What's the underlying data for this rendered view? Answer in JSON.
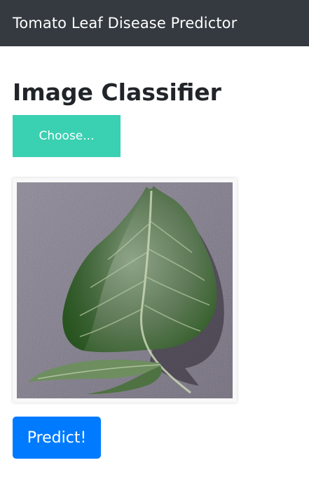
{
  "navbar": {
    "brand": "Tomato Leaf Disease Predictor"
  },
  "main": {
    "title": "Image Classifier",
    "choose_label": "Choose...",
    "predict_label": "Predict!"
  },
  "colors": {
    "navbar_bg": "#343a40",
    "choose_bg": "#3ad0b2",
    "predict_bg": "#007bff"
  }
}
